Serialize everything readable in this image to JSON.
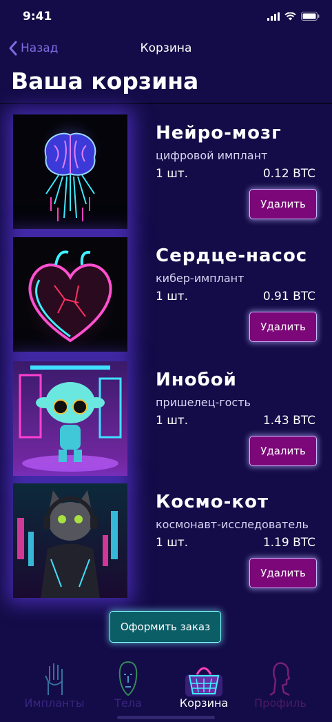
{
  "status": {
    "time": "9:41"
  },
  "nav": {
    "back_label": "Назад",
    "title": "Корзина"
  },
  "page_title": "Ваша корзина",
  "cart": [
    {
      "name": "Нейро-мозг",
      "subtitle": "цифровой имплант",
      "qty": "1 шт.",
      "price": "0.12 BTC",
      "delete_label": "Удалить",
      "image": "neon-brain"
    },
    {
      "name": "Сердце-насос",
      "subtitle": "кибер-имплант",
      "qty": "1 шт.",
      "price": "0.91 BTC",
      "delete_label": "Удалить",
      "image": "neon-heart"
    },
    {
      "name": "Инобой",
      "subtitle": "пришелец-гость",
      "qty": "1 шт.",
      "price": "1.43 BTC",
      "delete_label": "Удалить",
      "image": "neon-alien"
    },
    {
      "name": "Космо-кот",
      "subtitle": "космонавт-исследователь",
      "qty": "1 шт.",
      "price": "1.19 BTC",
      "delete_label": "Удалить",
      "image": "neon-cat"
    }
  ],
  "checkout_label": "Оформить заказ",
  "tabs": [
    {
      "label": "Импланты",
      "icon": "hand-icon",
      "color": "#3a2580",
      "active": false
    },
    {
      "label": "Тела",
      "icon": "face-icon",
      "color": "#3a2580",
      "active": false
    },
    {
      "label": "Корзина",
      "icon": "basket-icon",
      "color": "#ffffff",
      "active": true
    },
    {
      "label": "Профиль",
      "icon": "profile-icon",
      "color": "#4a1a6a",
      "active": false
    }
  ],
  "colors": {
    "background": "#140c48",
    "accent": "#7d6ce0",
    "delete_button": "#7b0778",
    "checkout_button": "#0b5d66"
  }
}
